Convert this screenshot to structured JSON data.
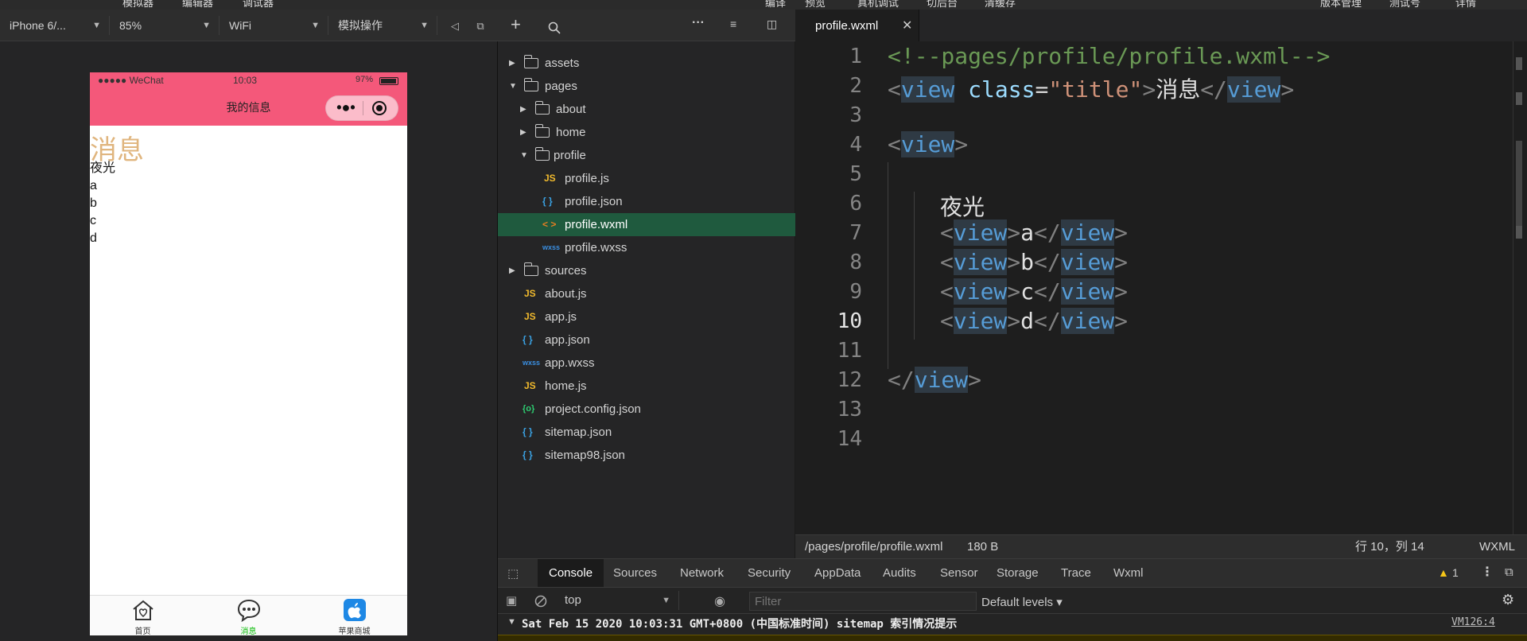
{
  "top_menu": [
    "模拟器",
    "编辑器",
    "调试器",
    "编译",
    "预览",
    "真机调试",
    "切后台",
    "清缓存",
    "版本管理",
    "测试号",
    "详情"
  ],
  "sim_toolbar": {
    "device": "iPhone 6/...",
    "zoom": "85%",
    "network": "WiFi",
    "operation": "模拟操作"
  },
  "phone": {
    "status": {
      "signal": "●●●●● WeChat",
      "time": "10:03",
      "battery": "97%"
    },
    "nav_title": "我的信息",
    "content": {
      "title": "消息",
      "lines": [
        "夜光",
        "a",
        "b",
        "c",
        "d"
      ]
    },
    "tabs": [
      {
        "label": "首页",
        "icon": "home-heart-icon",
        "active": false
      },
      {
        "label": "消息",
        "icon": "chat-bubble-icon",
        "active": true
      },
      {
        "label": "苹果商城",
        "icon": "apple-store-icon",
        "active": false
      }
    ]
  },
  "explorer": {
    "items": [
      {
        "label": "assets",
        "type": "folder",
        "expanded": false,
        "depth": 0
      },
      {
        "label": "pages",
        "type": "folder",
        "expanded": true,
        "depth": 0
      },
      {
        "label": "about",
        "type": "folder",
        "expanded": false,
        "depth": 1
      },
      {
        "label": "home",
        "type": "folder",
        "expanded": false,
        "depth": 1
      },
      {
        "label": "profile",
        "type": "folder",
        "expanded": true,
        "depth": 1
      },
      {
        "label": "profile.js",
        "type": "js",
        "depth": 2
      },
      {
        "label": "profile.json",
        "type": "json",
        "depth": 2
      },
      {
        "label": "profile.wxml",
        "type": "wxml",
        "depth": 2,
        "active": true
      },
      {
        "label": "profile.wxss",
        "type": "wxss",
        "depth": 2
      },
      {
        "label": "sources",
        "type": "folder",
        "expanded": false,
        "depth": 0
      },
      {
        "label": "about.js",
        "type": "js",
        "depth": 0
      },
      {
        "label": "app.js",
        "type": "js",
        "depth": 0
      },
      {
        "label": "app.json",
        "type": "json",
        "depth": 0
      },
      {
        "label": "app.wxss",
        "type": "wxss",
        "depth": 0
      },
      {
        "label": "home.js",
        "type": "js",
        "depth": 0
      },
      {
        "label": "project.config.json",
        "type": "config",
        "depth": 0
      },
      {
        "label": "sitemap.json",
        "type": "json",
        "depth": 0
      },
      {
        "label": "sitemap98.json",
        "type": "json",
        "depth": 0
      }
    ]
  },
  "editor": {
    "tab": "profile.wxml",
    "current_line": 10,
    "line_count": 14
  },
  "editor_status": {
    "path": "/pages/profile/profile.wxml",
    "size": "180 B",
    "position": "行 10，列 14",
    "language": "WXML"
  },
  "devtools": {
    "tabs": [
      "Console",
      "Sources",
      "Network",
      "Security",
      "AppData",
      "Audits",
      "Sensor",
      "Storage",
      "Trace",
      "Wxml"
    ],
    "active_tab": "Console",
    "warning_count": "1",
    "context": "top",
    "filter_placeholder": "Filter",
    "levels": "Default levels ▾",
    "log": {
      "message": "Sat Feb 15 2020 10:03:31 GMT+0800 (中国标准时间) sitemap 索引情况提示",
      "source": "VM126:4"
    }
  },
  "colors": {
    "nav_pink": "#f4587a",
    "title_gold": "#e0b57e",
    "active_tab_green": "#09bb07",
    "explorer_active": "#1f5a3e"
  }
}
